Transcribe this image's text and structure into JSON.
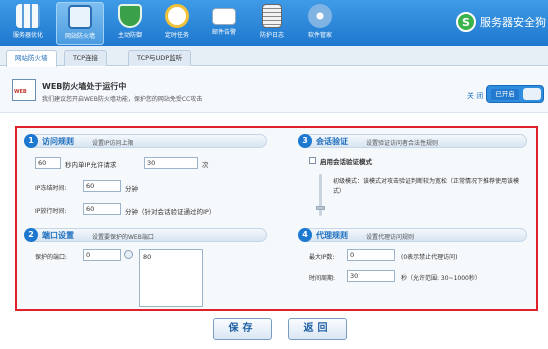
{
  "toolbar": {
    "buttons": [
      {
        "label": "服务器优化",
        "icon": "server-grid-icon",
        "color": "#5fa0de"
      },
      {
        "label": "网站防火墙",
        "icon": "firewall-screen-icon",
        "color": "#d0e6f8"
      },
      {
        "label": "主动防御",
        "icon": "shield-icon",
        "color": "#3aa14a"
      },
      {
        "label": "定时任务",
        "icon": "clock-icon",
        "color": "#f0c23a"
      },
      {
        "label": "邮件告警",
        "icon": "mail-icon",
        "color": "#ffffff"
      },
      {
        "label": "防护日志",
        "icon": "log-clipboard-icon",
        "color": "#f2f2f2"
      },
      {
        "label": "软件管家",
        "icon": "software-disc-icon",
        "color": "#7fb3e3"
      }
    ],
    "brand": "服务器安全狗"
  },
  "tabs": [
    "网站防火墙",
    "TCP连接",
    "TCP与UDP监听"
  ],
  "status": {
    "title": "WEB防火墙处于运行中",
    "subtitle": "我们建议您开启WEB防火墙功能，保护您的网站免受CC攻击",
    "icon_text": "WEB",
    "toggle_label": "关 闭",
    "toggle_state": "已开启",
    "accent": "#2f8de0"
  },
  "access_rule": {
    "num": "1",
    "title": "访问规则",
    "desc": "设置IP访问上限",
    "seconds": "60",
    "per_ip_text": "秒内单IP允许请求",
    "requests": "30",
    "times_unit": "次",
    "ban_label": "IP冻结时间:",
    "ban_value": "60",
    "ban_unit": "分钟",
    "release_label": "IP放行时间:",
    "release_value": "60",
    "release_unit": "分钟（针对会话验证通过的IP）"
  },
  "port_settings": {
    "num": "2",
    "title": "端口设置",
    "desc": "设置要保护的WEB端口",
    "label": "保护的端口:",
    "input_value": "0",
    "ports": [
      "80"
    ]
  },
  "session_verify": {
    "num": "3",
    "title": "会话验证",
    "desc": "设置验证访问者合法性规则",
    "checkbox_label": "启用会话验证模式",
    "checked": false,
    "mode_text": "初级模式：该模式对攻击验证判断较为宽松（正常情况下推荐使用该模式）"
  },
  "proxy_rule": {
    "num": "4",
    "title": "代理规则",
    "desc": "设置代理访问规则",
    "max_label": "最大IP数:",
    "max_value": "0",
    "max_hint": "(0表示禁止代理访问)",
    "period_label": "时间周期:",
    "period_value": "30",
    "period_hint": "秒（允许范围: 30~1000秒）"
  },
  "footer": {
    "save": "保存",
    "back": "返回"
  },
  "highlight_color": "#e0202a"
}
